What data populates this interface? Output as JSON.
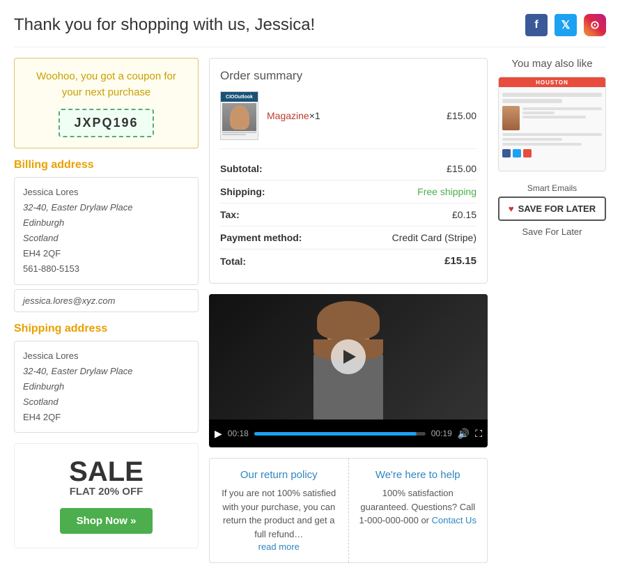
{
  "header": {
    "title": "Thank you for shopping with us, Jessica!",
    "social": {
      "facebook_label": "f",
      "twitter_label": "t",
      "instagram_label": "ig"
    }
  },
  "coupon": {
    "text_line1": "Woohoo, you got a coupon for",
    "text_line2": "your next purchase",
    "code": "JXPQ196"
  },
  "billing": {
    "title": "Billing address",
    "name": "Jessica Lores",
    "address1": "32-40, Easter Drylaw Place",
    "city": "Edinburgh",
    "region": "Scotland",
    "postcode": "EH4 2QF",
    "phone": "561-880-5153",
    "email": "jessica.lores@xyz.com"
  },
  "shipping": {
    "title": "Shipping address",
    "name": "Jessica Lores",
    "address1": "32-40, Easter Drylaw Place",
    "city": "Edinburgh",
    "region": "Scotland",
    "postcode": "EH4 2QF"
  },
  "sale": {
    "title": "SALE",
    "subtitle": "FLAT 20% OFF",
    "button_label": "Shop Now »"
  },
  "order_summary": {
    "title": "Order summary",
    "product": {
      "name": "Magazine",
      "qty_label": "×1",
      "price": "£15.00"
    },
    "rows": [
      {
        "label": "Subtotal:",
        "value": "£15.00",
        "type": "normal"
      },
      {
        "label": "Shipping:",
        "value": "Free shipping",
        "type": "free"
      },
      {
        "label": "Tax:",
        "value": "£0.15",
        "type": "normal"
      },
      {
        "label": "Payment method:",
        "value": "Credit Card (Stripe)",
        "type": "normal"
      },
      {
        "label": "Total:",
        "value": "£15.15",
        "type": "total"
      }
    ]
  },
  "video": {
    "current_time": "00:18",
    "total_time": "00:19",
    "progress_percent": 95
  },
  "return_policy": {
    "title": "Our return policy",
    "text": "If you are not 100% satisfied with your purchase, you can return the product and get a full refund…",
    "read_more": "read more"
  },
  "help": {
    "title": "We're here to help",
    "text": "100% satisfaction guaranteed. Questions? Call 1-000-000-000 or",
    "contact_label": "Contact Us"
  },
  "sidebar": {
    "you_may_like": "You may also like",
    "product_label": "Smart Emails",
    "save_btn_label": "SAVE FOR LATER",
    "save_label": "Save For Later"
  }
}
